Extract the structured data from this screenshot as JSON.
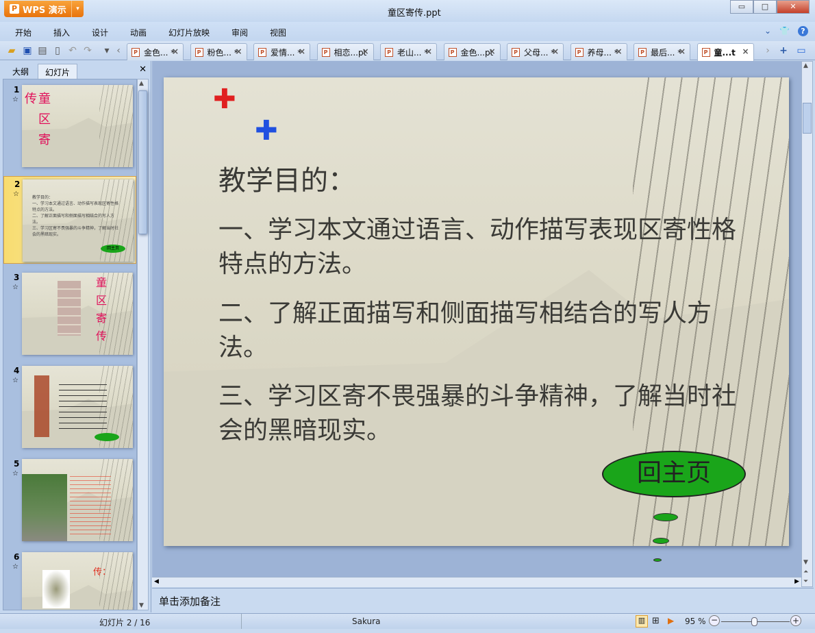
{
  "app": {
    "name": "WPS 演示",
    "title": "童区寄传.ppt"
  },
  "window": {
    "minimize": "▭",
    "maximize": "□",
    "close": "✕"
  },
  "menu": [
    "开始",
    "插入",
    "设计",
    "动画",
    "幻灯片放映",
    "审阅",
    "视图"
  ],
  "doc_tabs": [
    {
      "label": "金色... *"
    },
    {
      "label": "粉色... *"
    },
    {
      "label": "爱情... *"
    },
    {
      "label": "相恋...pt"
    },
    {
      "label": "老山... *"
    },
    {
      "label": "金色...pt"
    },
    {
      "label": "父母... *"
    },
    {
      "label": "养母... *"
    },
    {
      "label": "最后... *"
    },
    {
      "label": "童...t",
      "active": true
    }
  ],
  "panel": {
    "tabs": [
      "大纲",
      "幻灯片"
    ],
    "active_tab": "幻灯片"
  },
  "thumbnails": [
    {
      "num": "1",
      "chars": [
        "传",
        "童",
        "区",
        "寄"
      ]
    },
    {
      "num": "2",
      "selected": true
    },
    {
      "num": "3",
      "chars": [
        "童",
        "区",
        "寄",
        "传"
      ]
    },
    {
      "num": "4"
    },
    {
      "num": "5"
    },
    {
      "num": "6",
      "text": "传："
    }
  ],
  "slide": {
    "title": "教学目的：",
    "points": [
      "一、学习本文通过语言、动作描写表现区寄性格特点的方法。",
      "二、了解正面描写和侧面描写相结合的写人方法。",
      "三、学习区寄不畏强暴的斗争精神，了解当时社会的黑暗现实。"
    ],
    "home_button": "回主页",
    "colors": {
      "cloud": "#1aa51a",
      "text": "#3a3a36",
      "thumb_title": "#e0105a"
    }
  },
  "notes_placeholder": "单击添加备注",
  "status": {
    "slide": "幻灯片 2 / 16",
    "theme": "Sakura",
    "zoom": "95 %",
    "zoom_percent": 95
  }
}
